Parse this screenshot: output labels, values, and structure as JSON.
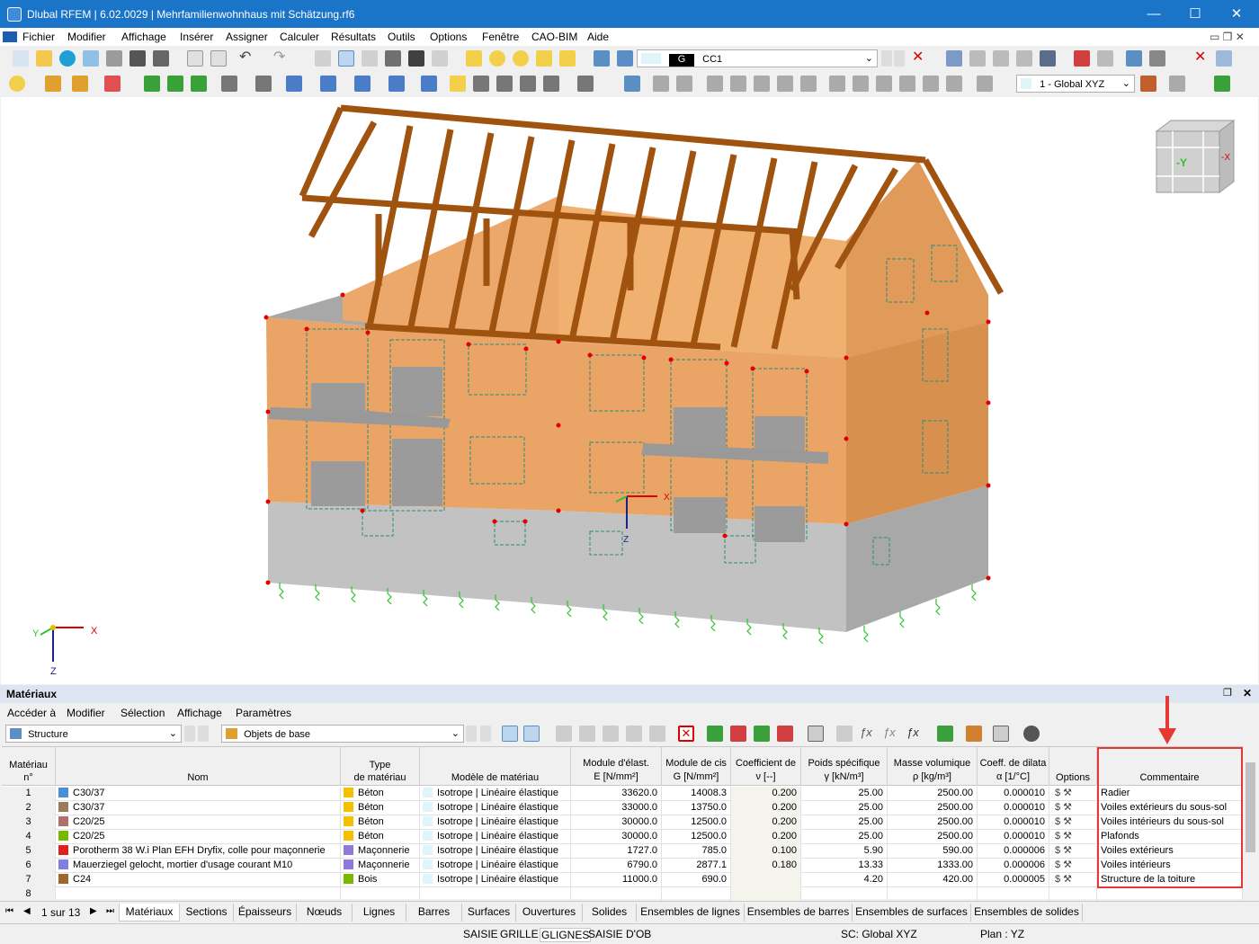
{
  "window": {
    "title": "Dlubal RFEM | 6.02.0029 | Mehrfamilienwohnhaus mit Schätzung.rf6",
    "minimize": "—",
    "maximize": "☐",
    "close": "✕"
  },
  "menu": [
    "Fichier",
    "Modifier",
    "Affichage",
    "Insérer",
    "Assigner",
    "Calculer",
    "Résultats",
    "Outils",
    "Options",
    "Fenêtre",
    "CAO-BIM",
    "Aide"
  ],
  "toolbar": {
    "loadcase_tag": "G",
    "loadcase": "CC1",
    "coord_system": "1 - Global XYZ"
  },
  "viewport": {
    "navcube_y": "-Y",
    "navcube_x": "-X",
    "axis_x": "X",
    "axis_y": "Y",
    "axis_z": "Z"
  },
  "panel": {
    "title": "Matériaux",
    "menu": [
      "Accéder à",
      "Modifier",
      "Sélection",
      "Affichage",
      "Paramètres"
    ],
    "filter1": "Structure",
    "filter2": "Objets de base"
  },
  "table": {
    "headers": {
      "no": [
        "Matériau",
        "n°"
      ],
      "name": [
        "",
        "Nom"
      ],
      "type": [
        "Type",
        "de matériau"
      ],
      "model": [
        "",
        "Modèle de matériau"
      ],
      "E": [
        "Module d'élast.",
        "E [N/mm²]"
      ],
      "G": [
        "Module de cis",
        "G [N/mm²]"
      ],
      "nu": [
        "Coefficient de",
        "ν [--]"
      ],
      "gamma": [
        "Poids spécifique",
        "γ [kN/m³]"
      ],
      "rho": [
        "Masse volumique",
        "ρ [kg/m³]"
      ],
      "alpha": [
        "Coeff. de dilata",
        "α [1/°C]"
      ],
      "options": [
        "",
        "Options"
      ],
      "comment": [
        "",
        "Commentaire"
      ]
    },
    "rows": [
      {
        "no": "1",
        "name": "C30/37",
        "name_color": "#4a90d9",
        "type": "Béton",
        "type_color": "#f5c000",
        "model": "Isotrope | Linéaire élastique",
        "E": "33620.0",
        "G": "14008.3",
        "nu": "0.200",
        "gamma": "25.00",
        "rho": "2500.00",
        "alpha": "0.000010",
        "comment": "Radier"
      },
      {
        "no": "2",
        "name": "C30/37",
        "name_color": "#9b7b5a",
        "type": "Béton",
        "type_color": "#f5c000",
        "model": "Isotrope | Linéaire élastique",
        "E": "33000.0",
        "G": "13750.0",
        "nu": "0.200",
        "gamma": "25.00",
        "rho": "2500.00",
        "alpha": "0.000010",
        "comment": "Voiles extérieurs du sous-sol"
      },
      {
        "no": "3",
        "name": "C20/25",
        "name_color": "#b07070",
        "type": "Béton",
        "type_color": "#f5c000",
        "model": "Isotrope | Linéaire élastique",
        "E": "30000.0",
        "G": "12500.0",
        "nu": "0.200",
        "gamma": "25.00",
        "rho": "2500.00",
        "alpha": "0.000010",
        "comment": "Voiles intérieurs du sous-sol"
      },
      {
        "no": "4",
        "name": "C20/25",
        "name_color": "#7ab800",
        "type": "Béton",
        "type_color": "#f5c000",
        "model": "Isotrope | Linéaire élastique",
        "E": "30000.0",
        "G": "12500.0",
        "nu": "0.200",
        "gamma": "25.00",
        "rho": "2500.00",
        "alpha": "0.000010",
        "comment": "Plafonds"
      },
      {
        "no": "5",
        "name": "Porotherm 38 W.i Plan EFH Dryfix, colle pour maçonnerie",
        "name_color": "#e02020",
        "type": "Maçonnerie",
        "type_color": "#8f7ad9",
        "model": "Isotrope | Linéaire élastique",
        "E": "1727.0",
        "G": "785.0",
        "nu": "0.100",
        "gamma": "5.90",
        "rho": "590.00",
        "alpha": "0.000006",
        "comment": "Voiles extérieurs"
      },
      {
        "no": "6",
        "name": "Mauerziegel gelocht, mortier d'usage courant M10",
        "name_color": "#8080e0",
        "type": "Maçonnerie",
        "type_color": "#8f7ad9",
        "model": "Isotrope | Linéaire élastique",
        "E": "6790.0",
        "G": "2877.1",
        "nu": "0.180",
        "gamma": "13.33",
        "rho": "1333.00",
        "alpha": "0.000006",
        "comment": "Voiles intérieurs"
      },
      {
        "no": "7",
        "name": "C24",
        "name_color": "#9b6a2a",
        "type": "Bois",
        "type_color": "#7ab800",
        "model": "Isotrope | Linéaire élastique",
        "E": "11000.0",
        "G": "690.0",
        "nu": "",
        "gamma": "4.20",
        "rho": "420.00",
        "alpha": "0.000005",
        "comment": "Structure de la toiture"
      },
      {
        "no": "8",
        "name": "",
        "name_color": "",
        "type": "",
        "type_color": "",
        "model": "",
        "E": "",
        "G": "",
        "nu": "",
        "gamma": "",
        "rho": "",
        "alpha": "",
        "comment": ""
      }
    ]
  },
  "pager": "1 sur 13",
  "tabs": [
    "Matériaux",
    "Sections",
    "Épaisseurs",
    "Nœuds",
    "Lignes",
    "Barres",
    "Surfaces",
    "Ouvertures",
    "Solides",
    "Ensembles de lignes",
    "Ensembles de barres",
    "Ensembles de surfaces",
    "Ensembles de solides"
  ],
  "status": {
    "saisie": "SAISIE",
    "grille": "GRILLE",
    "glignes": "GLIGNES",
    "saisie_ob": "SAISIE D'OB",
    "sc": "SC: Global XYZ",
    "plan": "Plan : YZ"
  },
  "colors": {
    "titlebar": "#1a74c8",
    "highlight": "#e53935",
    "timber": "#a0520f",
    "wall": "#e8a062",
    "basement": "#b4b4b4"
  }
}
